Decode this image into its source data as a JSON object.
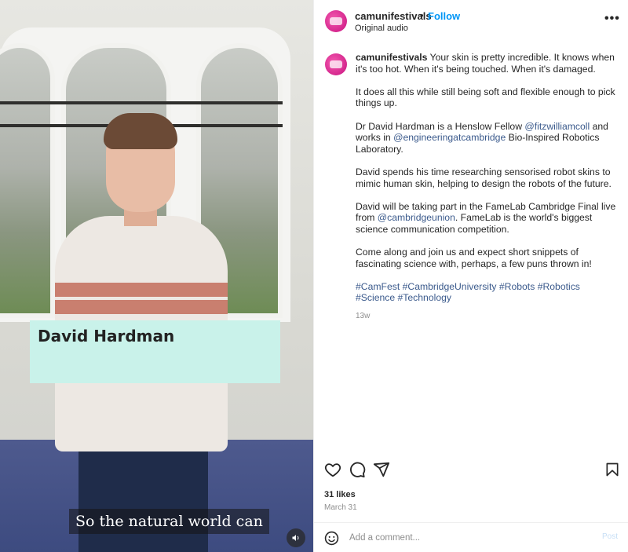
{
  "video": {
    "name_card": "David Hardman",
    "caption": "So the natural world can",
    "mute_icon": "volume-icon"
  },
  "post": {
    "header": {
      "username": "camunifestivals",
      "separator": "•",
      "follow_label": "Follow",
      "audio_label": "Original audio",
      "more_icon": "more-options-icon",
      "more_label": "•••"
    },
    "caption": {
      "username": "camunifestivals",
      "p1_text": " Your skin is pretty incredible. It knows when it's too hot. When it's being touched. When it's damaged.",
      "p2": "It does all this while still being soft and flexible enough to pick things up.",
      "p3_a": "Dr David Hardman is a Henslow Fellow ",
      "p3_link1": "@fitzwilliamcoll",
      "p3_b": " and works in ",
      "p3_link2": "@engineeringatcambridge",
      "p3_c": " Bio-Inspired Robotics Laboratory.",
      "p4": "David spends his time researching sensorised robot skins to mimic human skin, helping to design the robots of the future.",
      "p5_a": "David will be taking part in the FameLab Cambridge Final live from ",
      "p5_link": "@cambridgeunion",
      "p5_b": ". FameLab is the world's biggest science communication competition.",
      "p6": "Come along and join us and expect short snippets of fascinating science with, perhaps, a few puns thrown in!",
      "tags": [
        "#CamFest",
        "#CambridgeUniversity",
        "#Robots",
        "#Robotics",
        "#Science",
        "#Technology"
      ],
      "age": "13w"
    },
    "actions": {
      "like_icon": "heart-icon",
      "comment_icon": "comment-icon",
      "share_icon": "share-icon",
      "save_icon": "bookmark-icon"
    },
    "likes": "31 likes",
    "date": "March 31",
    "comment": {
      "emoji_icon": "emoji-icon",
      "placeholder": "Add a comment...",
      "post_label": "Post"
    }
  },
  "colors": {
    "accent": "#0095f6",
    "brand_avatar": "#d6198f",
    "name_card": "#c9f2ea",
    "link": "#3b5a8c"
  }
}
